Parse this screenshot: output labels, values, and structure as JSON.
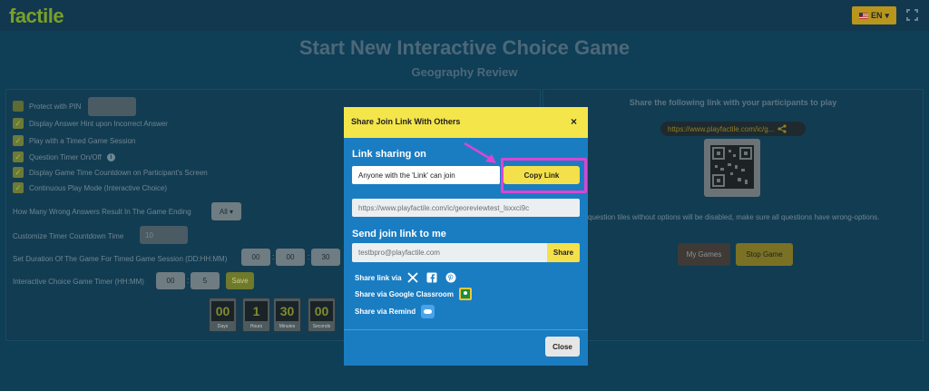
{
  "header": {
    "logo": "factile",
    "language": "EN"
  },
  "page": {
    "title": "Start New Interactive Choice Game",
    "subtitle": "Geography Review"
  },
  "settings": {
    "options": [
      "Protect with PIN",
      "Display Answer Hint upon Incorrect Answer",
      "Play with a Timed Game Session",
      "Question Timer On/Off",
      "Display Game Time Countdown on Participant's Screen",
      "Continuous Play Mode (Interactive Choice)"
    ],
    "wrong_answers_label": "How Many Wrong Answers Result In The Game Ending",
    "wrong_answers_value": "All",
    "timer_countdown_label": "Customize Timer Countdown Time",
    "timer_countdown_value": "10",
    "duration_label": "Set Duration Of The Game For Timed Game Session (DD:HH:MM)",
    "duration_values": [
      "00",
      "00",
      "30"
    ],
    "choice_timer_label": "Interactive Choice Game Timer (HH:MM)",
    "choice_timer_values": [
      "00",
      "5"
    ],
    "save_label": "Save",
    "countdown": [
      {
        "value": "00",
        "label": "Days"
      },
      {
        "value": "1",
        "label": "Hours"
      },
      {
        "value": "30",
        "label": "Minutes"
      },
      {
        "value": "00",
        "label": "Seconds"
      }
    ]
  },
  "right_panel": {
    "title": "Share the following link with your participants to play",
    "link": "https://www.playfactile.com/ic/g...",
    "warning": "question tiles without options will be disabled, make sure all questions have wrong-options.",
    "my_games": "My Games",
    "stop_game": "Stop Game"
  },
  "modal": {
    "title": "Share Join Link With Others",
    "close_x": "×",
    "link_sharing_heading": "Link sharing on",
    "sharing_mode": "Anyone with the 'Link' can join",
    "copy_link": "Copy Link",
    "url": "https://www.playfactile.com/ic/georeviewtest_lsxxci9c",
    "send_heading": "Send join link to me",
    "email_placeholder": "testbpro@playfactile.com",
    "share_button": "Share",
    "share_via": "Share link via",
    "share_classroom": "Share via Google Classroom",
    "share_remind": "Share via Remind",
    "close_button": "Close"
  },
  "colors": {
    "modal_blue": "#1a7dc2",
    "accent_yellow": "#f4e04a",
    "highlight_magenta": "#d946d3"
  }
}
